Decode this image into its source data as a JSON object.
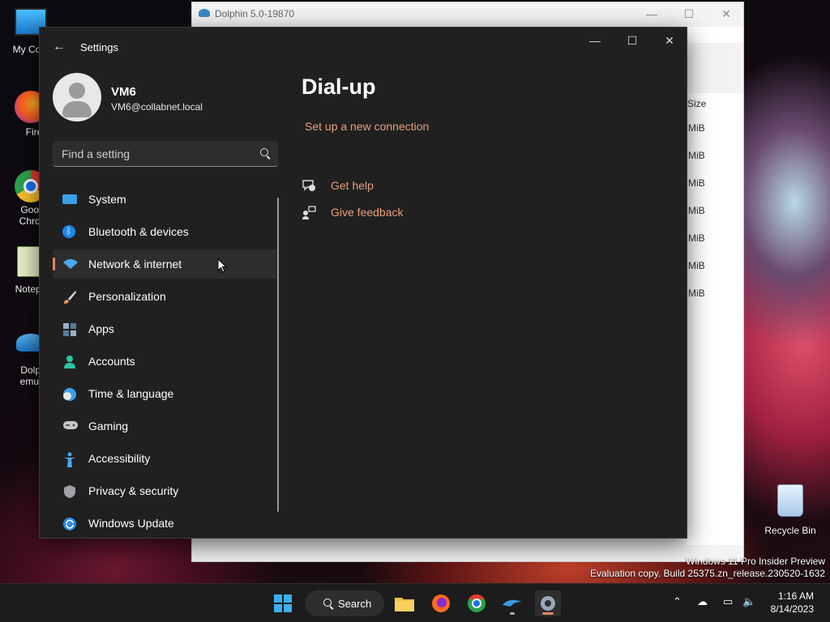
{
  "desktop": {
    "icons": [
      {
        "label": "My Com",
        "name": "my-computer"
      },
      {
        "label": "Firefo",
        "name": "firefox"
      },
      {
        "label": "Goog Chron",
        "label1": "Goog",
        "label2": "Chron",
        "name": "google-chrome"
      },
      {
        "label": "Notepa",
        "name": "notepad"
      },
      {
        "label1": "Dolph",
        "label2": "emula",
        "name": "dolphin-emulator"
      },
      {
        "label": "Recycle Bin",
        "name": "recycle-bin"
      }
    ]
  },
  "dolphin": {
    "title": "Dolphin 5.0-19870",
    "size_header": "Size",
    "sizes": [
      "MiB",
      "MiB",
      "MiB",
      "MiB",
      "MiB",
      "MiB",
      "MiB"
    ]
  },
  "settings": {
    "app_title": "Settings",
    "user": {
      "name": "VM6",
      "email": "VM6@collabnet.local"
    },
    "search_placeholder": "Find a setting",
    "nav": [
      {
        "label": "System",
        "icon": "system-icon",
        "color": "#3aa0e6"
      },
      {
        "label": "Bluetooth & devices",
        "icon": "bluetooth-icon",
        "color": "#1e88e5"
      },
      {
        "label": "Network & internet",
        "icon": "wifi-icon",
        "color": "#4aa8f0",
        "active": true
      },
      {
        "label": "Personalization",
        "icon": "brush-icon",
        "color": "#e89a5a"
      },
      {
        "label": "Apps",
        "icon": "apps-icon",
        "color": "#9ab0c8"
      },
      {
        "label": "Accounts",
        "icon": "accounts-icon",
        "color": "#2ec4a0"
      },
      {
        "label": "Time & language",
        "icon": "time-language-icon",
        "color": "#3aa0e6"
      },
      {
        "label": "Gaming",
        "icon": "gaming-icon",
        "color": "#c8c8c8"
      },
      {
        "label": "Accessibility",
        "icon": "accessibility-icon",
        "color": "#4aa8f0"
      },
      {
        "label": "Privacy & security",
        "icon": "shield-icon",
        "color": "#a0a0a8"
      },
      {
        "label": "Windows Update",
        "icon": "update-icon",
        "color": "#2a8ae0"
      }
    ],
    "page": {
      "title": "Dial-up",
      "setup_link": "Set up a new connection",
      "help": [
        {
          "label": "Get help",
          "icon": "help-icon"
        },
        {
          "label": "Give feedback",
          "icon": "feedback-icon"
        }
      ]
    }
  },
  "watermark": {
    "line1": "Windows 11 Pro Insider Preview",
    "line2": "Evaluation copy. Build 25375.zn_release.230520-1632"
  },
  "taskbar": {
    "search_label": "Search",
    "time": "1:16 AM",
    "date": "8/14/2023",
    "accent": "#e8815a"
  }
}
